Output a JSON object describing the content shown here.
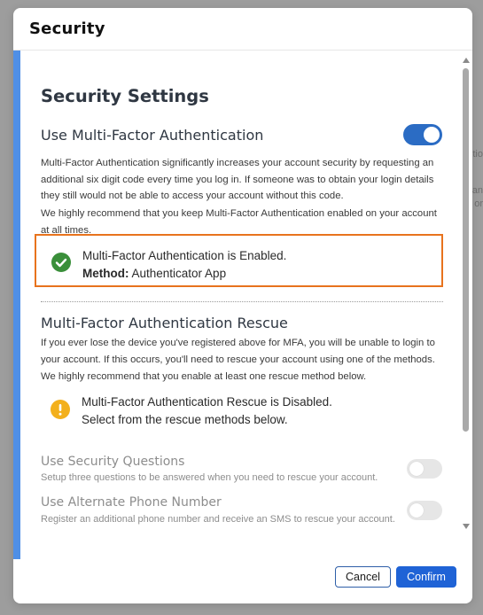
{
  "backdrop": {
    "fragments": [
      "tio",
      "an",
      "or"
    ]
  },
  "modal": {
    "title": "Security"
  },
  "settings": {
    "heading": "Security Settings",
    "mfa": {
      "label": "Use Multi-Factor Authentication",
      "enabled": true,
      "description_1": "Multi-Factor Authentication significantly increases your account security by requesting an additional six digit code every time you log in. If someone was to obtain your login details they still would not be able to access your account without this code.",
      "description_2": "We highly recommend that you keep Multi-Factor Authentication enabled on your account at all times.",
      "status_text": "Multi-Factor Authentication is Enabled.",
      "method_label": "Method:",
      "method_value": "Authenticator App"
    },
    "rescue": {
      "heading": "Multi-Factor Authentication Rescue",
      "description_1": "If you ever lose the device you've registered above for MFA, you will be unable to login to your account. If this occurs, you'll need to rescue your account using one of the methods.",
      "description_2": "We highly recommend that you enable at least one rescue method below.",
      "status_line_1": "Multi-Factor Authentication Rescue is Disabled.",
      "status_line_2": "Select from the rescue methods below.",
      "options": [
        {
          "label": "Use Security Questions",
          "description": "Setup three questions to be answered when you need to rescue your account.",
          "enabled": false
        },
        {
          "label": "Use Alternate Phone Number",
          "description": "Register an additional phone number and receive an SMS to rescue your account.",
          "enabled": false
        }
      ]
    }
  },
  "footer": {
    "cancel_label": "Cancel",
    "confirm_label": "Confirm"
  },
  "colors": {
    "accent": "#2b6cc4",
    "left_border": "#4f8fe6",
    "highlight_border": "#e8731d",
    "success": "#3a8f3a",
    "warning": "#f3b01c",
    "confirm_button": "#1f63d6"
  },
  "icons": {
    "status_enabled": "check-circle-icon",
    "status_warning": "exclamation-circle-icon"
  }
}
